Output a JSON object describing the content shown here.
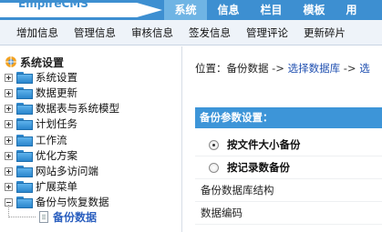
{
  "header": {
    "logo_text": "EmpireCMS",
    "tabs": [
      {
        "label": "系统",
        "active": true
      },
      {
        "label": "信息",
        "active": false
      },
      {
        "label": "栏目",
        "active": false
      },
      {
        "label": "模板",
        "active": false
      },
      {
        "label": "用",
        "active": false
      }
    ]
  },
  "submenu": {
    "items": [
      "增加信息",
      "管理信息",
      "审核信息",
      "签发信息",
      "管理评论",
      "更新碎片"
    ]
  },
  "tree": {
    "root": "系统设置",
    "items": [
      {
        "label": "系统设置",
        "expanded": false
      },
      {
        "label": "数据更新",
        "expanded": false
      },
      {
        "label": "数据表与系统模型",
        "expanded": false
      },
      {
        "label": "计划任务",
        "expanded": false
      },
      {
        "label": "工作流",
        "expanded": false
      },
      {
        "label": "优化方案",
        "expanded": false
      },
      {
        "label": "网站多访问端",
        "expanded": false
      },
      {
        "label": "扩展菜单",
        "expanded": false
      },
      {
        "label": "备份与恢复数据",
        "expanded": true
      }
    ],
    "selected_child": "备份数据"
  },
  "main": {
    "breadcrumb": {
      "prefix": "位置：",
      "item1": "备份数据",
      "sep1": " -> ",
      "item2": "选择数据库",
      "sep2": " -> ",
      "item3": "选"
    },
    "panel": {
      "title": "备份参数设置：",
      "options": [
        {
          "label": "按文件大小备份",
          "checked": true
        },
        {
          "label": "按记录数备份",
          "checked": false
        }
      ],
      "fields": [
        "备份数据库结构",
        "数据编码"
      ]
    }
  },
  "colors": {
    "header_blue": "#3d8fd1",
    "active_tab": "#6fb4e4",
    "panel_header": "#3d95d8",
    "link_blue": "#1f4fb0"
  }
}
